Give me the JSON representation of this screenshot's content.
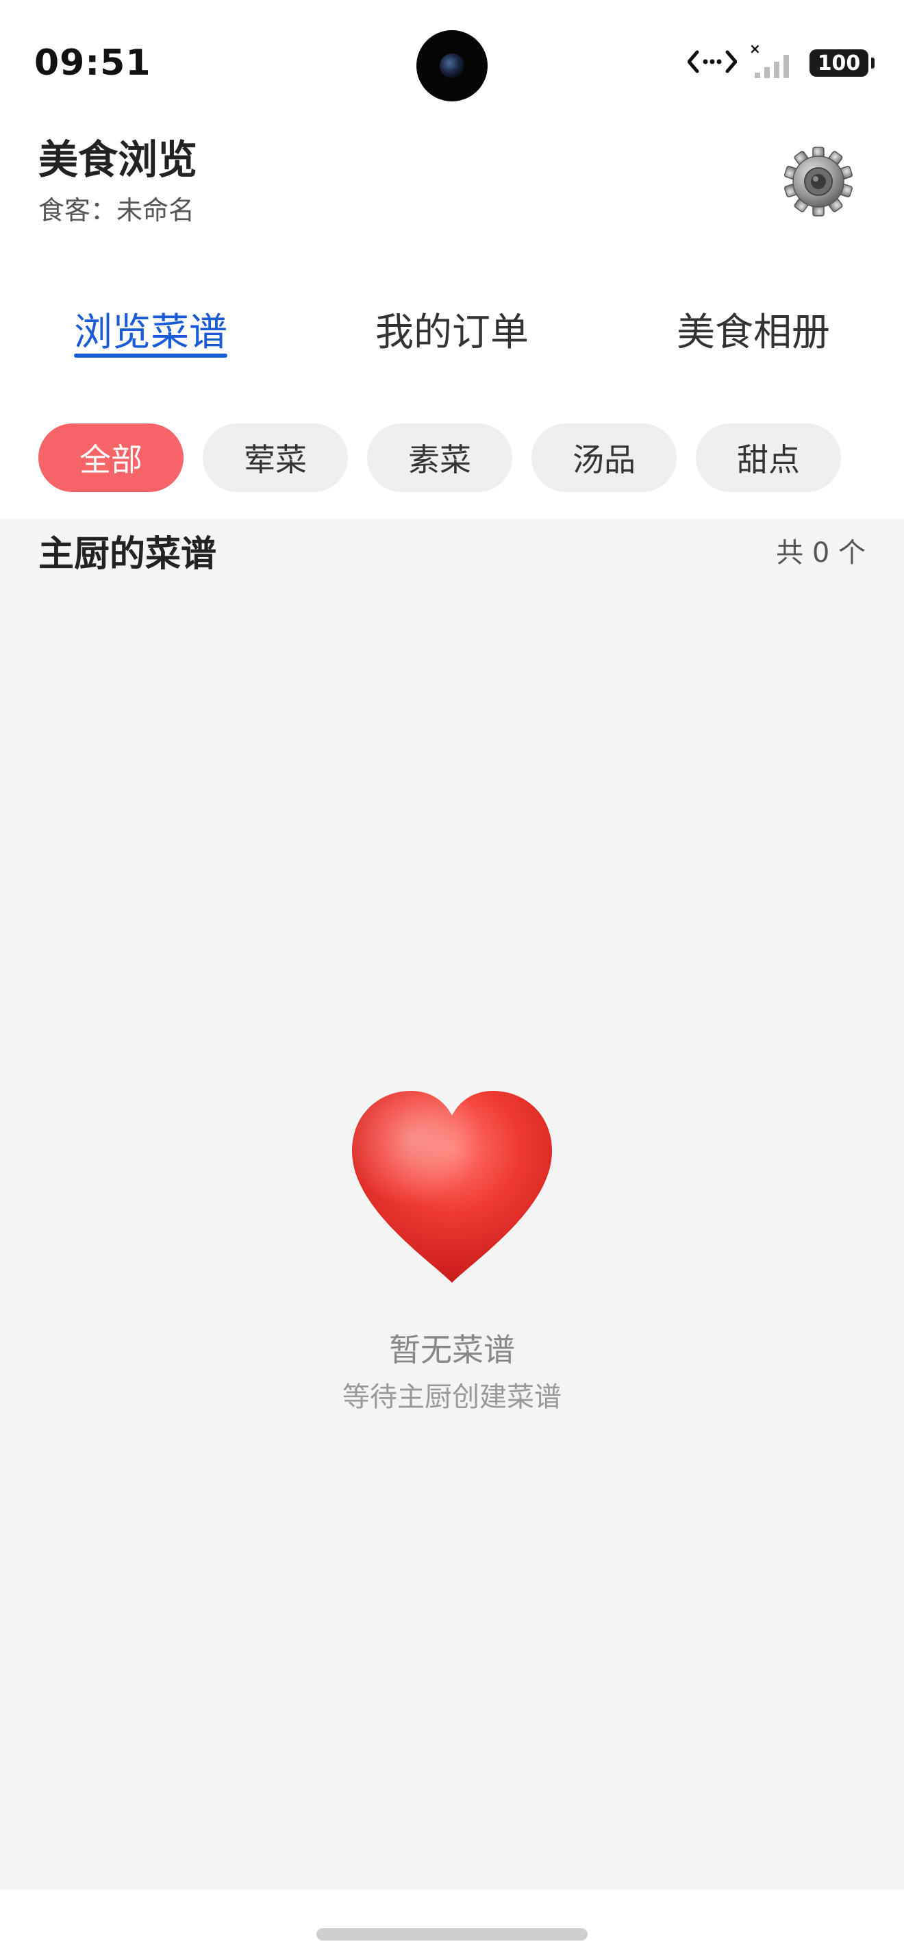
{
  "status_bar": {
    "time": "09:51",
    "battery": "100",
    "icons": [
      "data-transfer-icon",
      "no-sim-signal-icon",
      "battery-icon"
    ]
  },
  "header": {
    "title": "美食浏览",
    "subtitle": "食客：未命名",
    "settings_icon": "gear-icon"
  },
  "tabs": [
    {
      "label": "浏览菜谱",
      "active": true
    },
    {
      "label": "我的订单",
      "active": false
    },
    {
      "label": "美食相册",
      "active": false
    }
  ],
  "categories": [
    {
      "label": "全部",
      "active": true
    },
    {
      "label": "荤菜",
      "active": false
    },
    {
      "label": "素菜",
      "active": false
    },
    {
      "label": "汤品",
      "active": false
    },
    {
      "label": "甜点",
      "active": false
    }
  ],
  "section": {
    "title": "主厨的菜谱",
    "count": "共 0 个"
  },
  "empty_state": {
    "icon": "heart-icon",
    "title": "暂无菜谱",
    "description": "等待主厨创建菜谱"
  },
  "colors": {
    "accent_blue": "#1a5bd6",
    "chip_active": "#f76467",
    "chip_inactive": "#efefef",
    "content_bg": "#f4f4f4"
  }
}
